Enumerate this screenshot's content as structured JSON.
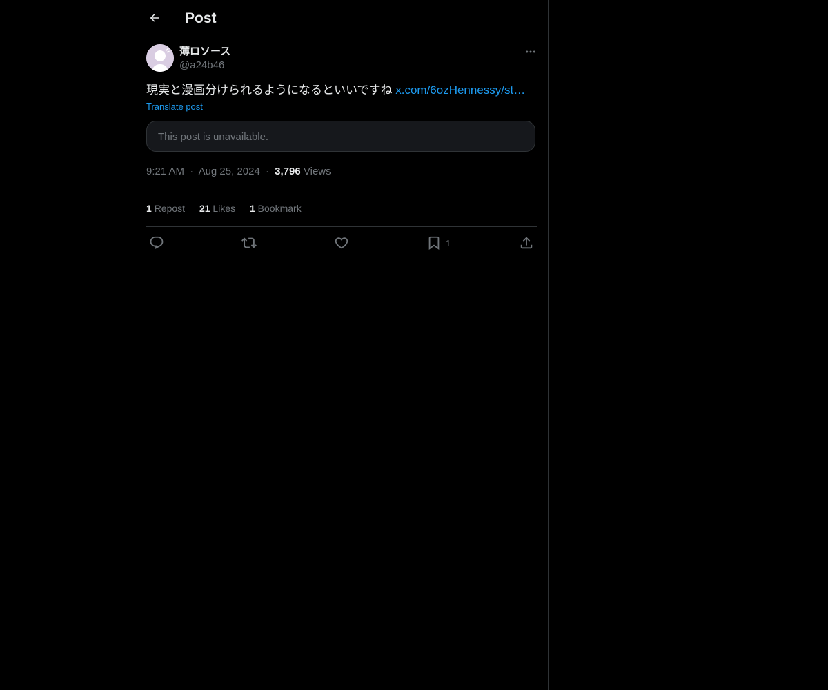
{
  "header": {
    "title": "Post",
    "back_icon": "back-arrow-icon"
  },
  "post": {
    "author": {
      "display_name": "薄ロソース",
      "handle": "@a24b46"
    },
    "text": "現実と漫画分けられるようになるといいですね",
    "link_text": "x.com/6ozHennessy/st…",
    "translate_label": "Translate post",
    "quoted_unavailable": "This post is unavailable.",
    "time": "9:21 AM",
    "date": "Aug 25, 2024",
    "views_count": "3,796",
    "views_label": "Views",
    "dot": "·"
  },
  "stats": {
    "reposts_count": "1",
    "reposts_label": "Repost",
    "likes_count": "21",
    "likes_label": "Likes",
    "bookmarks_count": "1",
    "bookmarks_label": "Bookmark"
  },
  "actions": {
    "reply_icon": "reply-icon",
    "repost_icon": "repost-icon",
    "like_icon": "heart-icon",
    "bookmark_icon": "bookmark-icon",
    "bookmark_count": "1",
    "share_icon": "share-icon"
  },
  "colors": {
    "background": "#000000",
    "text": "#e7e9ea",
    "muted": "#71767b",
    "accent": "#1d9bf0",
    "border": "#2f3336",
    "card": "#16181c"
  }
}
